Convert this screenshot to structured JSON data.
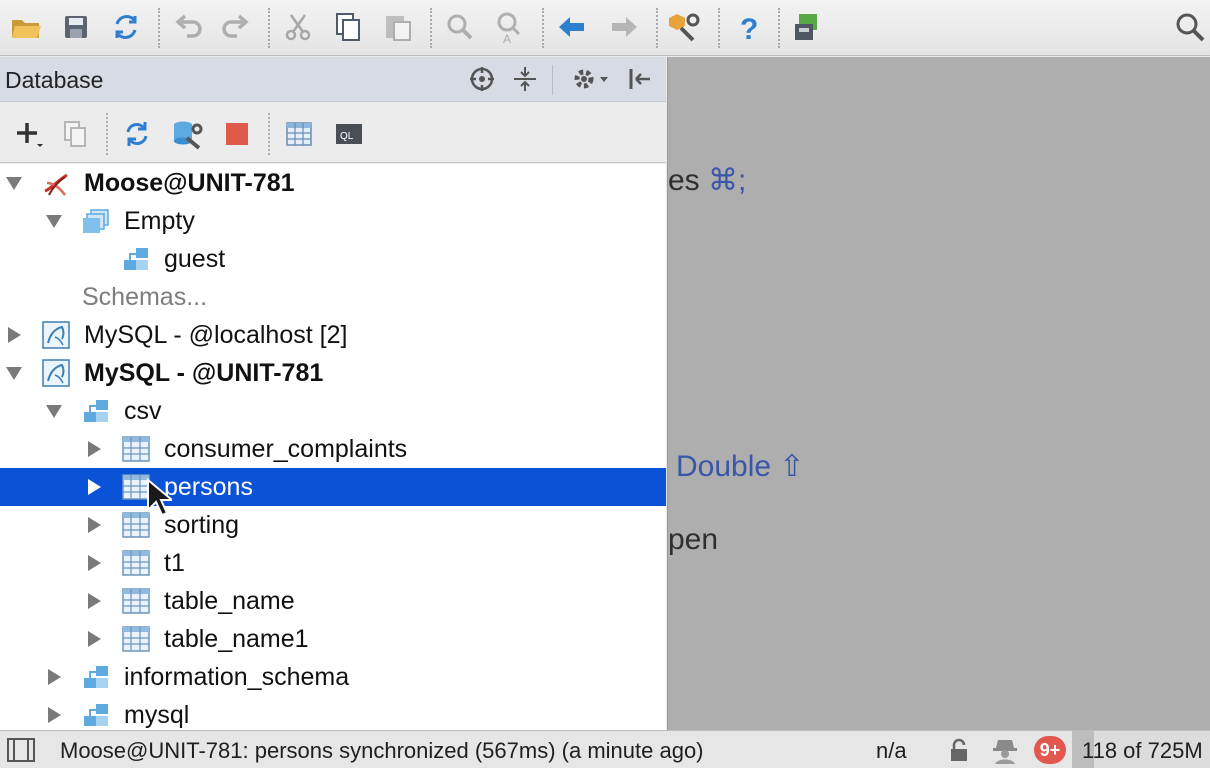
{
  "db_window": {
    "title": "Database"
  },
  "tree": {
    "rows": [
      {
        "label": "Moose@UNIT-781",
        "depth": 0,
        "bold": true,
        "expanded": true,
        "icon": "sqlserver-icon"
      },
      {
        "label": "Empty",
        "depth": 1,
        "bold": false,
        "expanded": true,
        "icon": "database-icon"
      },
      {
        "label": "guest",
        "depth": 2,
        "bold": false,
        "expanded": null,
        "icon": "schema-icon"
      },
      {
        "label": "Schemas...",
        "depth": 1,
        "muted": true,
        "expanded": null,
        "icon": null
      },
      {
        "label": "MySQL - @localhost [2]",
        "depth": 0,
        "bold": false,
        "expanded": false,
        "icon": "mysql-icon"
      },
      {
        "label": "MySQL - @UNIT-781",
        "depth": 0,
        "bold": true,
        "expanded": true,
        "icon": "mysql-icon"
      },
      {
        "label": "csv",
        "depth": 1,
        "bold": false,
        "expanded": true,
        "icon": "schema-icon"
      },
      {
        "label": "consumer_complaints",
        "depth": 2,
        "bold": false,
        "expanded": false,
        "icon": "table-icon"
      },
      {
        "label": "persons",
        "depth": 2,
        "bold": false,
        "expanded": false,
        "icon": "table-icon",
        "selected": true
      },
      {
        "label": "sorting",
        "depth": 2,
        "bold": false,
        "expanded": false,
        "icon": "table-icon"
      },
      {
        "label": "t1",
        "depth": 2,
        "bold": false,
        "expanded": false,
        "icon": "table-icon"
      },
      {
        "label": "table_name",
        "depth": 2,
        "bold": false,
        "expanded": false,
        "icon": "table-icon"
      },
      {
        "label": "table_name1",
        "depth": 2,
        "bold": false,
        "expanded": false,
        "icon": "table-icon"
      },
      {
        "label": "information_schema",
        "depth": 1,
        "bold": false,
        "expanded": false,
        "icon": "schema-icon"
      },
      {
        "label": "mysql",
        "depth": 1,
        "bold": false,
        "expanded": false,
        "icon": "schema-icon"
      }
    ]
  },
  "editor": {
    "hint_1_text": "es",
    "hint_1_key": "⌘;",
    "hint_2": "Double ⇧",
    "hint_3": "pen"
  },
  "status_bar": {
    "message": "Moose@UNIT-781: persons synchronized (567ms) (a minute ago)",
    "position": "n/a",
    "notifications": "9+",
    "memory": "118 of 725M",
    "memory_used_fraction": 0.16
  },
  "colors": {
    "selection": "#0b53d6",
    "tree_background": "#ffffff",
    "editor_background": "#aeaeae",
    "accent_blue": "#2f7fd1"
  }
}
